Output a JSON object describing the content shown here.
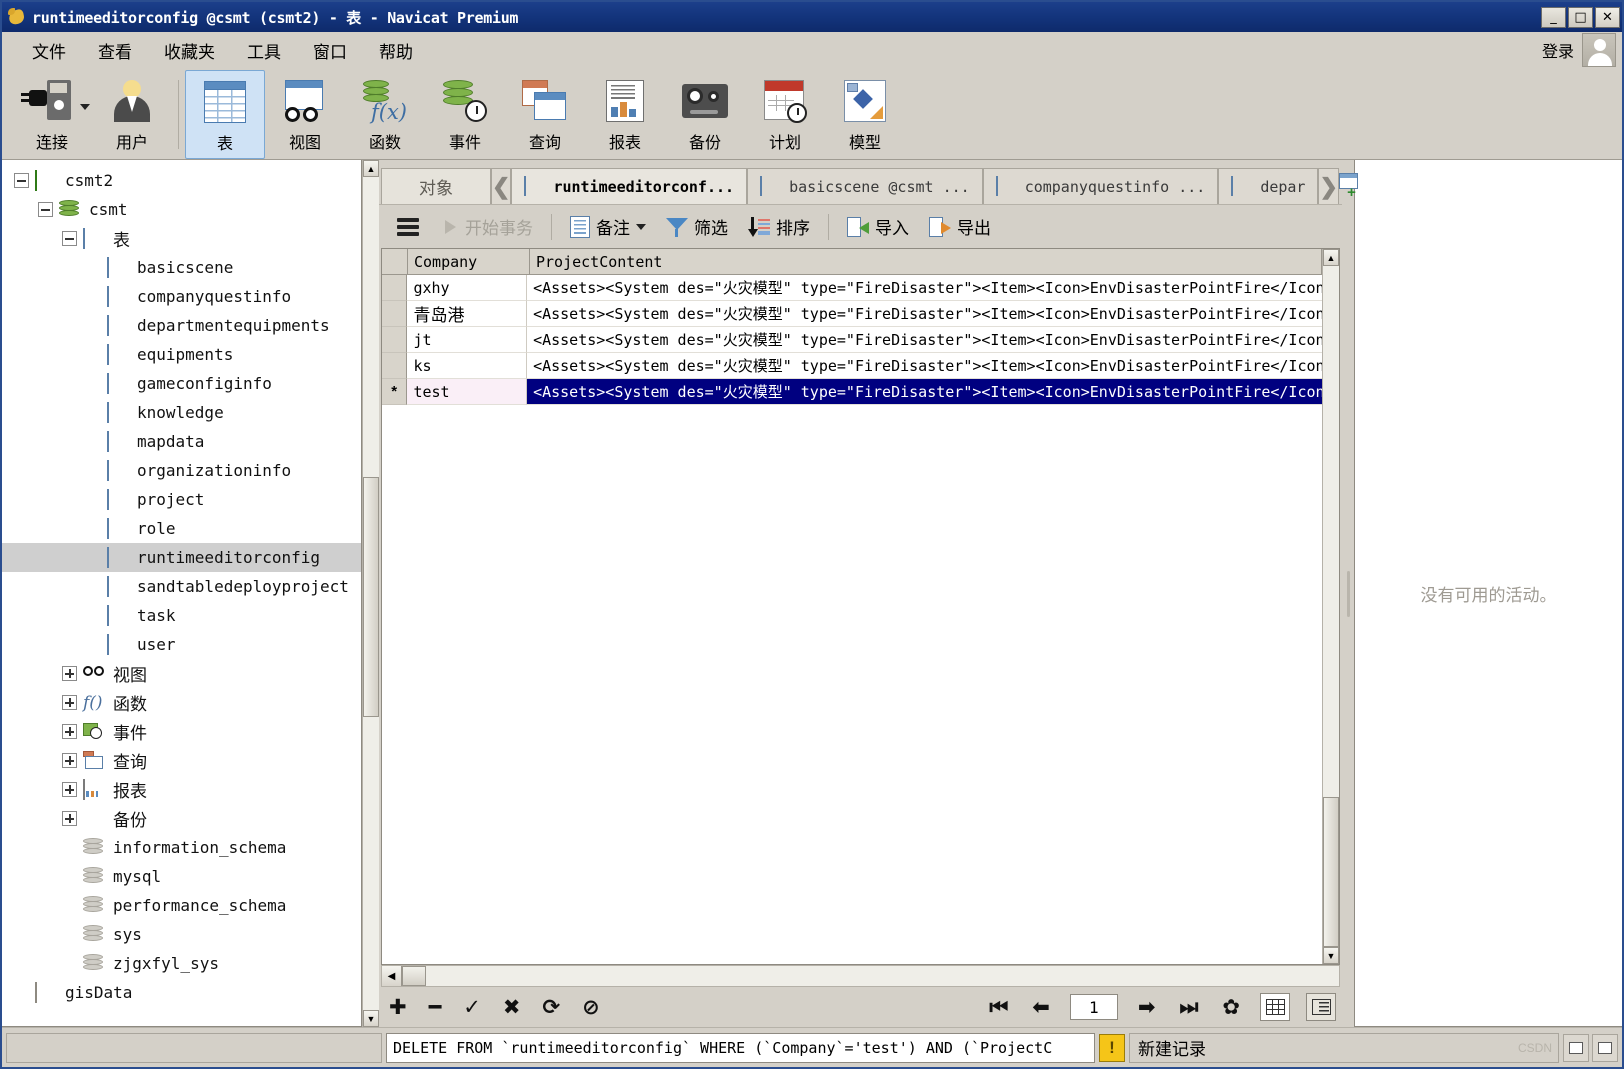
{
  "window": {
    "title": "runtimeeditorconfig @csmt (csmt2) - 表 - Navicat Premium",
    "minimize": "_",
    "maximize": "□",
    "close": "✕"
  },
  "menubar": {
    "items": [
      "文件",
      "查看",
      "收藏夹",
      "工具",
      "窗口",
      "帮助"
    ],
    "login_label": "登录"
  },
  "toolbar": {
    "items": [
      {
        "label": "连接",
        "icon": "connection-icon",
        "has_dropdown": true,
        "selected": false
      },
      {
        "label": "用户",
        "icon": "user-icon",
        "has_dropdown": false,
        "selected": false
      },
      {
        "label": "表",
        "icon": "table-icon",
        "has_dropdown": false,
        "selected": true
      },
      {
        "label": "视图",
        "icon": "view-icon",
        "has_dropdown": false,
        "selected": false
      },
      {
        "label": "函数",
        "icon": "function-icon",
        "has_dropdown": false,
        "selected": false
      },
      {
        "label": "事件",
        "icon": "event-icon",
        "has_dropdown": false,
        "selected": false
      },
      {
        "label": "查询",
        "icon": "query-icon",
        "has_dropdown": false,
        "selected": false
      },
      {
        "label": "报表",
        "icon": "report-icon",
        "has_dropdown": false,
        "selected": false
      },
      {
        "label": "备份",
        "icon": "backup-icon",
        "has_dropdown": false,
        "selected": false
      },
      {
        "label": "计划",
        "icon": "schedule-icon",
        "has_dropdown": false,
        "selected": false
      },
      {
        "label": "模型",
        "icon": "model-icon",
        "has_dropdown": false,
        "selected": false
      }
    ]
  },
  "sidebar": {
    "nodes": [
      {
        "label": "csmt2",
        "indent": 0,
        "icon": "connection-icon",
        "expander": "minus",
        "selected": false
      },
      {
        "label": "csmt",
        "indent": 1,
        "icon": "database-icon",
        "expander": "minus",
        "selected": false
      },
      {
        "label": "表",
        "indent": 2,
        "icon": "table-icon",
        "expander": "minus",
        "selected": false,
        "cjk": true
      },
      {
        "label": "basicscene",
        "indent": 3,
        "icon": "table-icon",
        "expander": "none",
        "selected": false
      },
      {
        "label": "companyquestinfo",
        "indent": 3,
        "icon": "table-icon",
        "expander": "none",
        "selected": false
      },
      {
        "label": "departmentequipments",
        "indent": 3,
        "icon": "table-icon",
        "expander": "none",
        "selected": false
      },
      {
        "label": "equipments",
        "indent": 3,
        "icon": "table-icon",
        "expander": "none",
        "selected": false
      },
      {
        "label": "gameconfiginfo",
        "indent": 3,
        "icon": "table-icon",
        "expander": "none",
        "selected": false
      },
      {
        "label": "knowledge",
        "indent": 3,
        "icon": "table-icon",
        "expander": "none",
        "selected": false
      },
      {
        "label": "mapdata",
        "indent": 3,
        "icon": "table-icon",
        "expander": "none",
        "selected": false
      },
      {
        "label": "organizationinfo",
        "indent": 3,
        "icon": "table-icon",
        "expander": "none",
        "selected": false
      },
      {
        "label": "project",
        "indent": 3,
        "icon": "table-icon",
        "expander": "none",
        "selected": false
      },
      {
        "label": "role",
        "indent": 3,
        "icon": "table-icon",
        "expander": "none",
        "selected": false
      },
      {
        "label": "runtimeeditorconfig",
        "indent": 3,
        "icon": "table-icon",
        "expander": "none",
        "selected": true
      },
      {
        "label": "sandtabledeployproject",
        "indent": 3,
        "icon": "table-icon",
        "expander": "none",
        "selected": false
      },
      {
        "label": "task",
        "indent": 3,
        "icon": "table-icon",
        "expander": "none",
        "selected": false
      },
      {
        "label": "user",
        "indent": 3,
        "icon": "table-icon",
        "expander": "none",
        "selected": false
      },
      {
        "label": "视图",
        "indent": 2,
        "icon": "glasses-icon",
        "expander": "plus",
        "selected": false,
        "cjk": true
      },
      {
        "label": "函数",
        "indent": 2,
        "icon": "fx-icon",
        "expander": "plus",
        "selected": false,
        "cjk": true
      },
      {
        "label": "事件",
        "indent": 2,
        "icon": "event-icon",
        "expander": "plus",
        "selected": false,
        "cjk": true
      },
      {
        "label": "查询",
        "indent": 2,
        "icon": "query-icon",
        "expander": "plus",
        "selected": false,
        "cjk": true
      },
      {
        "label": "报表",
        "indent": 2,
        "icon": "report-icon",
        "expander": "plus",
        "selected": false,
        "cjk": true
      },
      {
        "label": "备份",
        "indent": 2,
        "icon": "backup-icon",
        "expander": "plus",
        "selected": false,
        "cjk": true
      },
      {
        "label": "information_schema",
        "indent": 2,
        "icon": "database-gray-icon",
        "expander": "none",
        "selected": false
      },
      {
        "label": "mysql",
        "indent": 2,
        "icon": "database-gray-icon",
        "expander": "none",
        "selected": false
      },
      {
        "label": "performance_schema",
        "indent": 2,
        "icon": "database-gray-icon",
        "expander": "none",
        "selected": false
      },
      {
        "label": "sys",
        "indent": 2,
        "icon": "database-gray-icon",
        "expander": "none",
        "selected": false
      },
      {
        "label": "zjgxfyl_sys",
        "indent": 2,
        "icon": "database-gray-icon",
        "expander": "none",
        "selected": false
      },
      {
        "label": "gisData",
        "indent": 0,
        "icon": "connection-gray-icon",
        "expander": "none",
        "selected": false
      }
    ]
  },
  "tabbar": {
    "object_tab": "对象",
    "prev_arrow": "❮",
    "next_arrow": "❯",
    "tabs": [
      {
        "label": "runtimeeditorconf...",
        "active": true
      },
      {
        "label": "basicscene @csmt ...",
        "active": false
      },
      {
        "label": "companyquestinfo ...",
        "active": false
      },
      {
        "label": "depar",
        "active": false
      }
    ],
    "add_tab_label": "+"
  },
  "subtoolbar": {
    "menu_label": "",
    "begin_transaction": "开始事务",
    "note": "备注",
    "filter": "筛选",
    "sort": "排序",
    "import": "导入",
    "export": "导出"
  },
  "grid": {
    "columns": [
      "Company",
      "ProjectContent"
    ],
    "rows": [
      {
        "marker": "",
        "Company": "gxhy",
        "ProjectContent": "<Assets><System des=\"火灾模型\" type=\"FireDisaster\"><Item><Icon>EnvDisasterPointFire</Icon>",
        "selected": false,
        "cjk": false
      },
      {
        "marker": "",
        "Company": "青岛港",
        "ProjectContent": "<Assets><System des=\"火灾模型\" type=\"FireDisaster\"><Item><Icon>EnvDisasterPointFire</Icon>",
        "selected": false,
        "cjk": true
      },
      {
        "marker": "",
        "Company": "jt",
        "ProjectContent": "<Assets><System des=\"火灾模型\" type=\"FireDisaster\"><Item><Icon>EnvDisasterPointFire</Icon>",
        "selected": false,
        "cjk": false
      },
      {
        "marker": "",
        "Company": "ks",
        "ProjectContent": "<Assets><System des=\"火灾模型\" type=\"FireDisaster\"><Item><Icon>EnvDisasterPointFire</Icon>",
        "selected": false,
        "cjk": false
      },
      {
        "marker": "*",
        "Company": "test",
        "ProjectContent": "<Assets><System des=\"火灾模型\" type=\"FireDisaster\"><Item><Icon>EnvDisasterPointFire</Icon>",
        "selected": true,
        "cjk": false
      }
    ]
  },
  "recordbar": {
    "add": "✚",
    "remove": "━",
    "confirm": "✓",
    "cancel": "✖",
    "refresh": "⟳",
    "stop": "⊘",
    "first": "⏮",
    "prev": "⬅",
    "page": "1",
    "next": "➡",
    "last": "⏭",
    "settings": "✿",
    "grid_view": "grid-view-icon",
    "form_view": "form-view-icon"
  },
  "rightpanel": {
    "empty_text": "没有可用的活动。"
  },
  "statusbar": {
    "sql": "DELETE FROM `runtimeeditorconfig` WHERE (`Company`='test') AND (`ProjectC",
    "warning": "!",
    "message": "新建记录",
    "watermark": "CSDN"
  }
}
